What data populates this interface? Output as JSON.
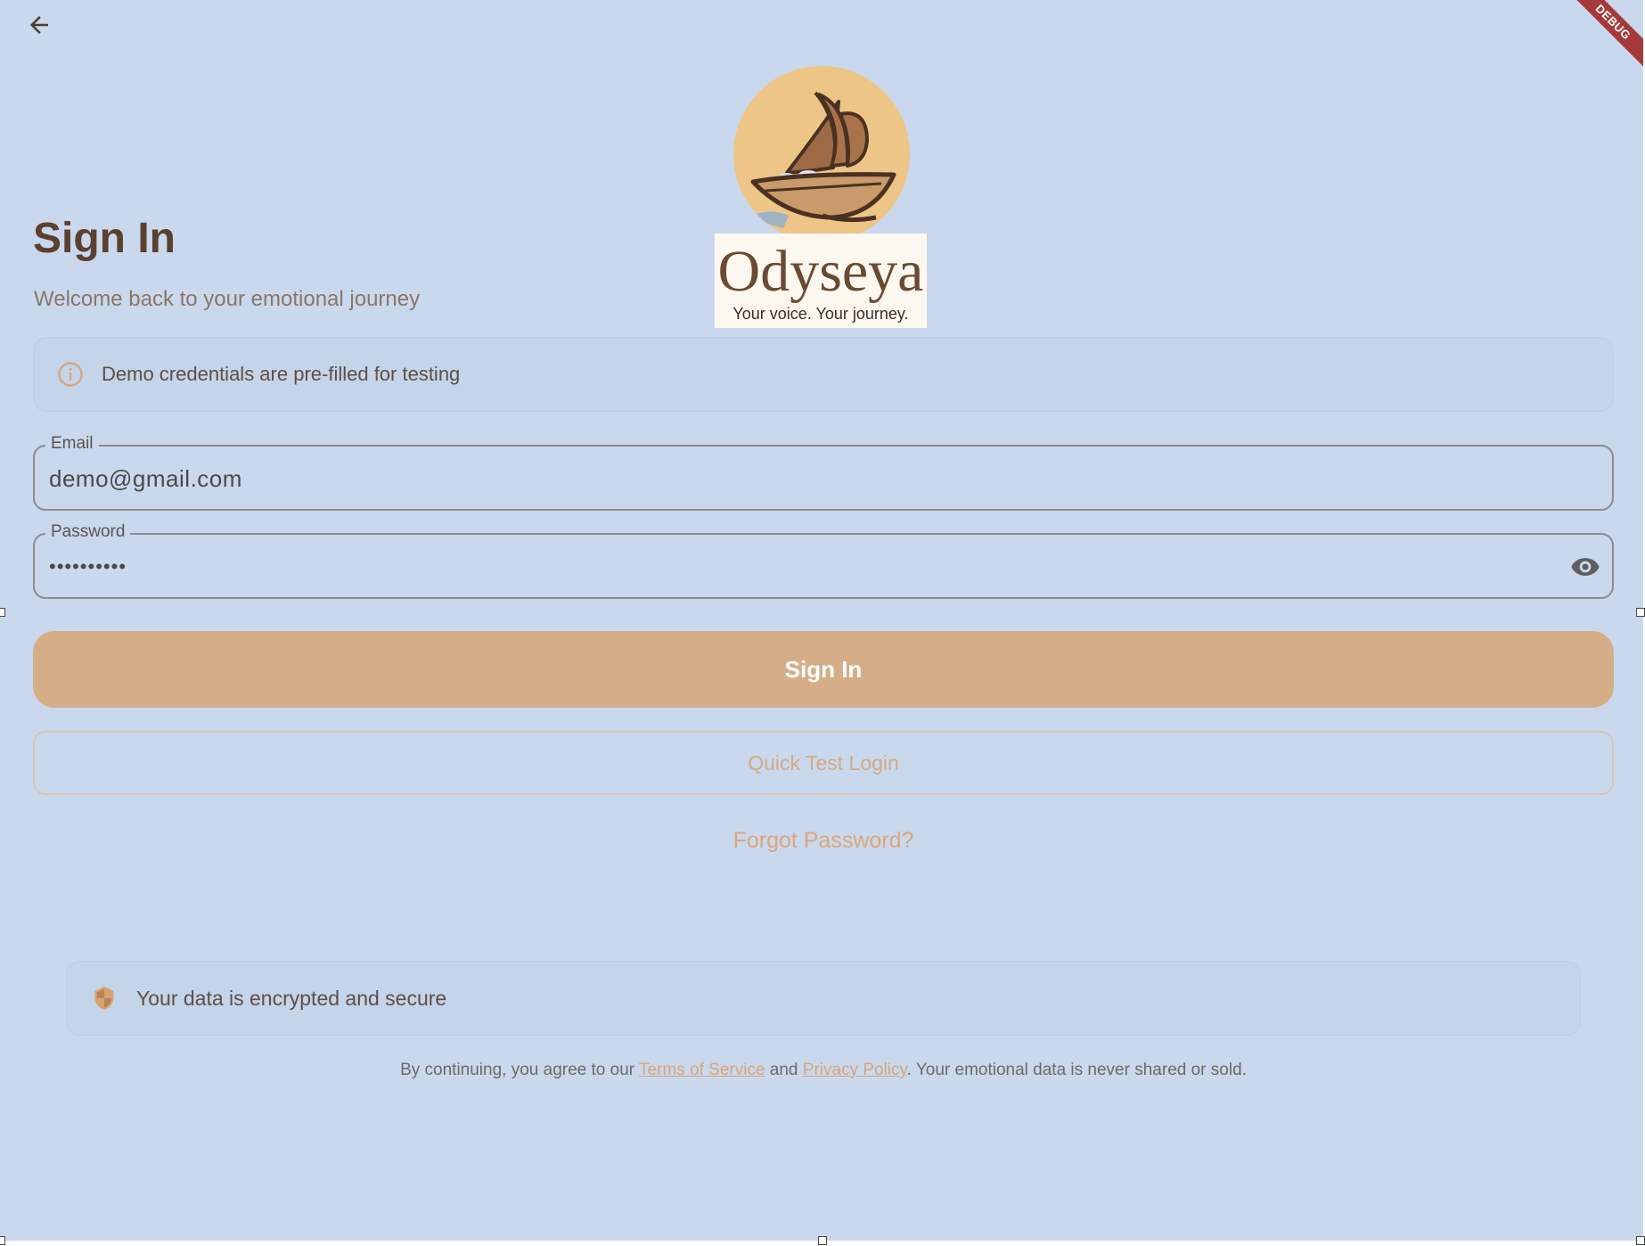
{
  "header": {
    "back_icon": "arrow-left-icon",
    "debug_banner": "DEBUG"
  },
  "logo": {
    "name": "Odyseya",
    "tagline": "Your voice. Your journey."
  },
  "page": {
    "title": "Sign In",
    "subtitle": "Welcome back to your emotional journey"
  },
  "info": {
    "icon": "info-icon",
    "text": "Demo credentials are pre-filled for testing"
  },
  "form": {
    "email": {
      "label": "Email",
      "value": "demo@gmail.com"
    },
    "password": {
      "label": "Password",
      "value": "••••••••••",
      "toggle_icon": "eye-icon"
    }
  },
  "actions": {
    "sign_in": "Sign In",
    "quick_login": "Quick Test Login",
    "forgot_password": "Forgot Password?"
  },
  "security": {
    "icon": "shield-icon",
    "text": "Your data is encrypted and secure"
  },
  "legal": {
    "prefix": "By continuing, you agree to our ",
    "terms": "Terms of Service",
    "and": " and ",
    "privacy": "Privacy Policy",
    "suffix": ". Your emotional data is never shared or sold."
  },
  "colors": {
    "background": "#c9d8ec",
    "accent": "#d5ae88",
    "title": "#5b4030",
    "debug": "#a63a3a"
  }
}
